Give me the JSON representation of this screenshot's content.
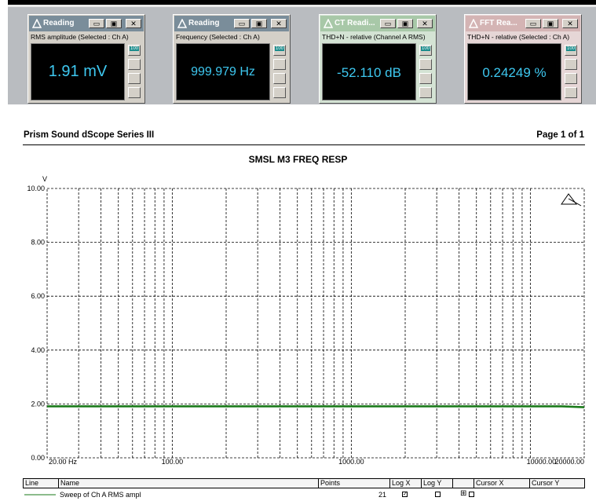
{
  "panels": [
    {
      "title": "Reading",
      "subtitle": "RMS amplitude (Selected : Ch A)",
      "value": "1.91 mV",
      "titlebar_color": "#7a8d9a"
    },
    {
      "title": "Reading",
      "subtitle": "Frequency (Selected : Ch A)",
      "value": "999.979 Hz",
      "titlebar_color": "#7a8d9a"
    },
    {
      "title": "CT Readi...",
      "subtitle": "THD+N - relative (Channel A RMS)",
      "value": "-52.110 dB",
      "titlebar_color": "#a8c8a8"
    },
    {
      "title": "FFT Rea...",
      "subtitle": "THD+N - relative (Selected : Ch A)",
      "value": "0.24249 %",
      "titlebar_color": "#d4b4b4"
    }
  ],
  "side_button_label": "100",
  "window_buttons": {
    "minimize": "▭",
    "restore": "▣",
    "close": "✕"
  },
  "document": {
    "header_left": "Prism Sound dScope Series III",
    "header_right": "Page 1 of 1"
  },
  "chart_data": {
    "type": "line",
    "title": "SMSL M3  FREQ RESP",
    "ylabel": "V",
    "xscale": "log",
    "xlim": [
      20,
      20000
    ],
    "ylim": [
      0,
      10
    ],
    "yticks": [
      0,
      2,
      4,
      6,
      8,
      10
    ],
    "ytick_labels": [
      "0.00",
      "2.00",
      "4.00",
      "6.00",
      "8.00",
      "10.00"
    ],
    "xtick_labels": [
      {
        "value": 20,
        "label": "20.00 Hz"
      },
      {
        "value": 100,
        "label": "100.00"
      },
      {
        "value": 1000,
        "label": "1000.00"
      },
      {
        "value": 10000,
        "label": "10000.00"
      },
      {
        "value": 20000,
        "label": "20000.00"
      }
    ],
    "grid": true,
    "series": [
      {
        "color": "#1a7a1a",
        "x": [
          20,
          30,
          50,
          100,
          200,
          500,
          1000,
          2000,
          5000,
          10000,
          15000,
          20000
        ],
        "values": [
          1.91,
          1.91,
          1.91,
          1.91,
          1.91,
          1.91,
          1.91,
          1.91,
          1.91,
          1.91,
          1.91,
          1.88
        ]
      }
    ]
  },
  "legend": {
    "headers": [
      "Line",
      "Name",
      "Points",
      "Log X",
      "Log Y",
      "Cursor X",
      "Cursor Y"
    ],
    "rows": [
      {
        "name": "Sweep of Ch A RMS ampl",
        "points": "21",
        "log_x_checked": true,
        "log_y_checked": false,
        "cursor_x": "⊞"
      }
    ]
  }
}
